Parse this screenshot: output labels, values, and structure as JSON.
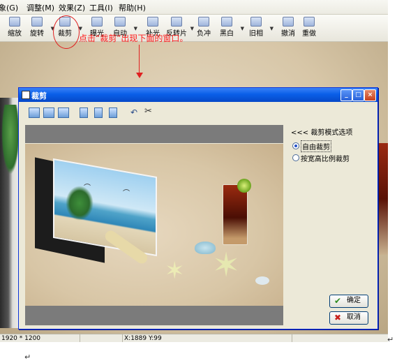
{
  "menu": {
    "items": [
      "象(G)",
      "调整(M)",
      "效果(Z)",
      "工具(I)",
      "帮助(H)"
    ]
  },
  "toolbar": {
    "buttons": [
      {
        "label": "缩放",
        "icon": "zoom-icon"
      },
      {
        "label": "旋转",
        "icon": "rotate-icon"
      },
      {
        "label": "裁剪",
        "icon": "crop-icon"
      },
      {
        "label": "曝光",
        "icon": "exposure-icon"
      },
      {
        "label": "自动",
        "icon": "auto-icon"
      },
      {
        "label": "补光",
        "icon": "fill-light-icon"
      },
      {
        "label": "反转片",
        "icon": "reversal-film-icon"
      },
      {
        "label": "负冲",
        "icon": "negative-process-icon"
      },
      {
        "label": "黑白",
        "icon": "black-white-icon"
      },
      {
        "label": "旧相",
        "icon": "old-photo-icon"
      },
      {
        "label": "撤消",
        "icon": "undo-icon"
      },
      {
        "label": "重做",
        "icon": "redo-icon"
      }
    ]
  },
  "annotation": "点击“裁剪”出现下面的窗口。",
  "dialog": {
    "title": "裁剪",
    "panel_title": "<<< 裁剪模式选项",
    "options": [
      {
        "label": "自由裁剪",
        "selected": true
      },
      {
        "label": "按宽高比例裁剪",
        "selected": false
      }
    ],
    "ok_label": "确定",
    "cancel_label": "取消",
    "ok_mark": "✔",
    "cancel_mark": "✖"
  },
  "statusbar": {
    "dimensions": "1920 * 1200",
    "cursor": "X:1889 Y:99"
  },
  "paragraph_mark": "↵"
}
